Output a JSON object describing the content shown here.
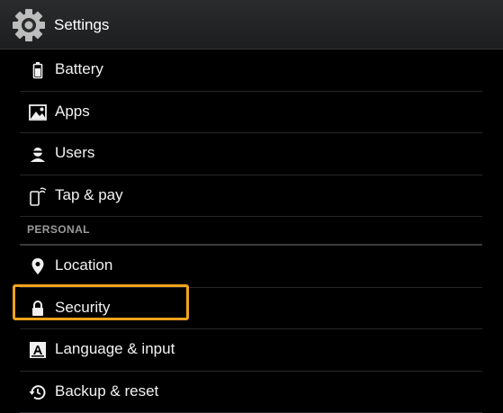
{
  "header": {
    "title": "Settings",
    "icon": "settings-gear-icon"
  },
  "items_top": [
    {
      "label": "Battery",
      "icon": "battery-icon"
    },
    {
      "label": "Apps",
      "icon": "apps-icon"
    },
    {
      "label": "Users",
      "icon": "users-icon"
    },
    {
      "label": "Tap & pay",
      "icon": "tap-pay-icon"
    }
  ],
  "section": {
    "label": "PERSONAL"
  },
  "items_personal": [
    {
      "label": "Location",
      "icon": "location-pin-icon"
    },
    {
      "label": "Security",
      "icon": "lock-icon",
      "highlighted": true
    },
    {
      "label": "Language & input",
      "icon": "language-keyboard-icon"
    },
    {
      "label": "Backup & reset",
      "icon": "backup-reset-icon"
    }
  ],
  "colors": {
    "highlight": "#f2a21e",
    "background": "#000000",
    "header": "#242526"
  }
}
